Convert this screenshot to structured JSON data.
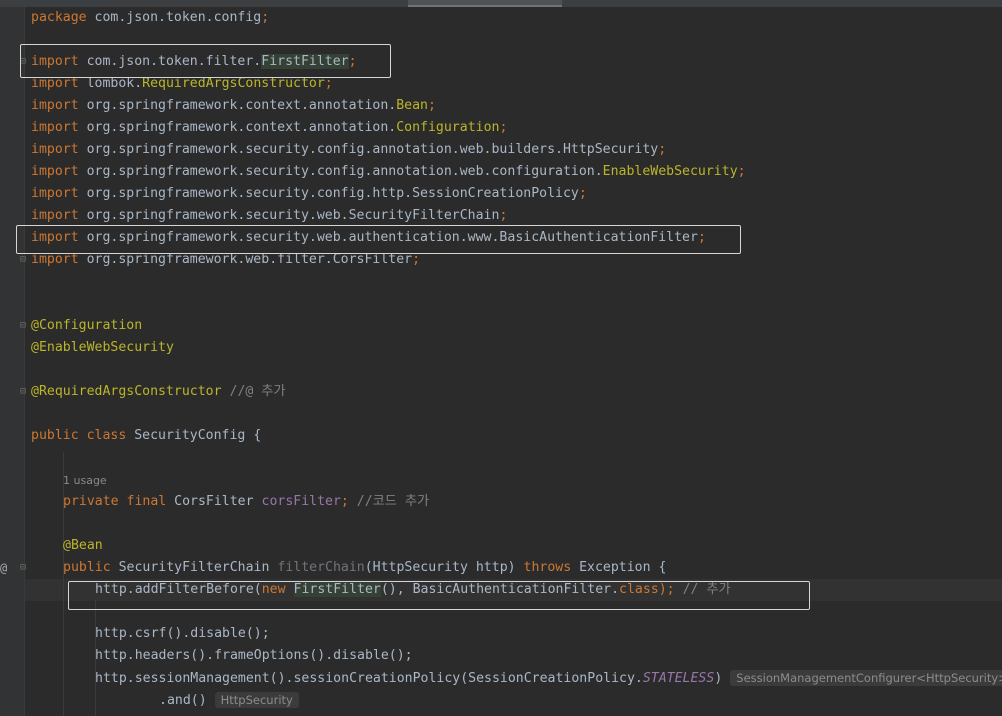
{
  "editor": {
    "gutter_marker": "@",
    "lines": {
      "l1_pkg": "package",
      "l1_name": " com.json.token.config",
      "imp": "import",
      "i1_path": " com.json.token.filter.",
      "i1_cls": "FirstFilter",
      "i2_path": " lombok.",
      "i2_cls": "RequiredArgsConstructor",
      "i3_path": " org.springframework.context.annotation.",
      "i3_cls": "Bean",
      "i4_path": " org.springframework.context.annotation.",
      "i4_cls": "Configuration",
      "i5_path": " org.springframework.security.config.annotation.web.builders.HttpSecurity",
      "i6_path": " org.springframework.security.config.annotation.web.configuration.",
      "i6_cls": "EnableWebSecurity",
      "i7_path": " org.springframework.security.config.http.SessionCreationPolicy",
      "i8_path": " org.springframework.security.web.SecurityFilterChain",
      "i9_path": " org.springframework.security.web.authentication.www.BasicAuthenticationFilter",
      "i10_path": " org.springframework.web.filter.CorsFilter",
      "semi": ";",
      "a1": "@Configuration",
      "a2": "@EnableWebSecurity",
      "a3": "@RequiredArgsConstructor",
      "a3_cm": " //@ 추가",
      "cls_public": "public",
      "cls_class": " class",
      "cls_name": " SecurityConfig {",
      "usage": "1 usage",
      "f_mods": "private final",
      "f_type": " CorsFilter ",
      "f_name": "corsFilter",
      "f_cm": " //코드 추가",
      "bean": "@Bean",
      "m_public": "public",
      "m_type": " SecurityFilterChain ",
      "m_name": "filterChain",
      "m_params": "(HttpSecurity http) ",
      "m_throws": "throws",
      "m_exc": " Exception {",
      "b1_a": "http.addFilterBefore(",
      "b1_new": "new ",
      "b1_ff": "FirstFilter",
      "b1_b": "(), BasicAuthenticationFilter.",
      "b1_class": "class",
      "b1_c": ");",
      "b1_cm": " // 추가",
      "b2": "http.csrf().disable();",
      "b3": "http.headers().frameOptions().disable();",
      "b4_a": "http.sessionManagement().sessionCreationPolicy(SessionCreationPolicy.",
      "b4_const": "STATELESS",
      "b4_b": ")",
      "b4_hint": "SessionManagementConfigurer<HttpSecurity>",
      "b5": ".and()",
      "b5_hint": "HttpSecurity"
    }
  }
}
